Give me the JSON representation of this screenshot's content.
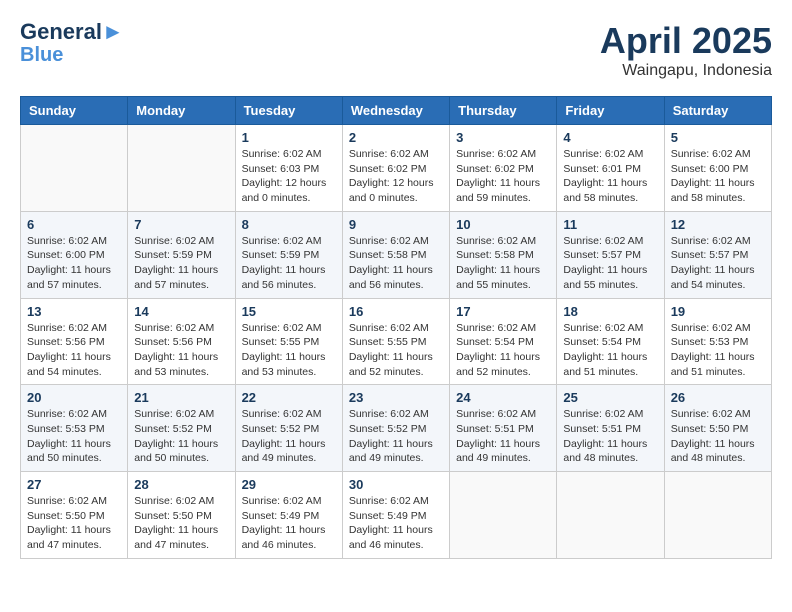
{
  "header": {
    "logo_line1": "General",
    "logo_line2": "Blue",
    "month": "April 2025",
    "location": "Waingapu, Indonesia"
  },
  "weekdays": [
    "Sunday",
    "Monday",
    "Tuesday",
    "Wednesday",
    "Thursday",
    "Friday",
    "Saturday"
  ],
  "weeks": [
    [
      {
        "day": "",
        "info": ""
      },
      {
        "day": "",
        "info": ""
      },
      {
        "day": "1",
        "info": "Sunrise: 6:02 AM\nSunset: 6:03 PM\nDaylight: 12 hours\nand 0 minutes."
      },
      {
        "day": "2",
        "info": "Sunrise: 6:02 AM\nSunset: 6:02 PM\nDaylight: 12 hours\nand 0 minutes."
      },
      {
        "day": "3",
        "info": "Sunrise: 6:02 AM\nSunset: 6:02 PM\nDaylight: 11 hours\nand 59 minutes."
      },
      {
        "day": "4",
        "info": "Sunrise: 6:02 AM\nSunset: 6:01 PM\nDaylight: 11 hours\nand 58 minutes."
      },
      {
        "day": "5",
        "info": "Sunrise: 6:02 AM\nSunset: 6:00 PM\nDaylight: 11 hours\nand 58 minutes."
      }
    ],
    [
      {
        "day": "6",
        "info": "Sunrise: 6:02 AM\nSunset: 6:00 PM\nDaylight: 11 hours\nand 57 minutes."
      },
      {
        "day": "7",
        "info": "Sunrise: 6:02 AM\nSunset: 5:59 PM\nDaylight: 11 hours\nand 57 minutes."
      },
      {
        "day": "8",
        "info": "Sunrise: 6:02 AM\nSunset: 5:59 PM\nDaylight: 11 hours\nand 56 minutes."
      },
      {
        "day": "9",
        "info": "Sunrise: 6:02 AM\nSunset: 5:58 PM\nDaylight: 11 hours\nand 56 minutes."
      },
      {
        "day": "10",
        "info": "Sunrise: 6:02 AM\nSunset: 5:58 PM\nDaylight: 11 hours\nand 55 minutes."
      },
      {
        "day": "11",
        "info": "Sunrise: 6:02 AM\nSunset: 5:57 PM\nDaylight: 11 hours\nand 55 minutes."
      },
      {
        "day": "12",
        "info": "Sunrise: 6:02 AM\nSunset: 5:57 PM\nDaylight: 11 hours\nand 54 minutes."
      }
    ],
    [
      {
        "day": "13",
        "info": "Sunrise: 6:02 AM\nSunset: 5:56 PM\nDaylight: 11 hours\nand 54 minutes."
      },
      {
        "day": "14",
        "info": "Sunrise: 6:02 AM\nSunset: 5:56 PM\nDaylight: 11 hours\nand 53 minutes."
      },
      {
        "day": "15",
        "info": "Sunrise: 6:02 AM\nSunset: 5:55 PM\nDaylight: 11 hours\nand 53 minutes."
      },
      {
        "day": "16",
        "info": "Sunrise: 6:02 AM\nSunset: 5:55 PM\nDaylight: 11 hours\nand 52 minutes."
      },
      {
        "day": "17",
        "info": "Sunrise: 6:02 AM\nSunset: 5:54 PM\nDaylight: 11 hours\nand 52 minutes."
      },
      {
        "day": "18",
        "info": "Sunrise: 6:02 AM\nSunset: 5:54 PM\nDaylight: 11 hours\nand 51 minutes."
      },
      {
        "day": "19",
        "info": "Sunrise: 6:02 AM\nSunset: 5:53 PM\nDaylight: 11 hours\nand 51 minutes."
      }
    ],
    [
      {
        "day": "20",
        "info": "Sunrise: 6:02 AM\nSunset: 5:53 PM\nDaylight: 11 hours\nand 50 minutes."
      },
      {
        "day": "21",
        "info": "Sunrise: 6:02 AM\nSunset: 5:52 PM\nDaylight: 11 hours\nand 50 minutes."
      },
      {
        "day": "22",
        "info": "Sunrise: 6:02 AM\nSunset: 5:52 PM\nDaylight: 11 hours\nand 49 minutes."
      },
      {
        "day": "23",
        "info": "Sunrise: 6:02 AM\nSunset: 5:52 PM\nDaylight: 11 hours\nand 49 minutes."
      },
      {
        "day": "24",
        "info": "Sunrise: 6:02 AM\nSunset: 5:51 PM\nDaylight: 11 hours\nand 49 minutes."
      },
      {
        "day": "25",
        "info": "Sunrise: 6:02 AM\nSunset: 5:51 PM\nDaylight: 11 hours\nand 48 minutes."
      },
      {
        "day": "26",
        "info": "Sunrise: 6:02 AM\nSunset: 5:50 PM\nDaylight: 11 hours\nand 48 minutes."
      }
    ],
    [
      {
        "day": "27",
        "info": "Sunrise: 6:02 AM\nSunset: 5:50 PM\nDaylight: 11 hours\nand 47 minutes."
      },
      {
        "day": "28",
        "info": "Sunrise: 6:02 AM\nSunset: 5:50 PM\nDaylight: 11 hours\nand 47 minutes."
      },
      {
        "day": "29",
        "info": "Sunrise: 6:02 AM\nSunset: 5:49 PM\nDaylight: 11 hours\nand 46 minutes."
      },
      {
        "day": "30",
        "info": "Sunrise: 6:02 AM\nSunset: 5:49 PM\nDaylight: 11 hours\nand 46 minutes."
      },
      {
        "day": "",
        "info": ""
      },
      {
        "day": "",
        "info": ""
      },
      {
        "day": "",
        "info": ""
      }
    ]
  ]
}
